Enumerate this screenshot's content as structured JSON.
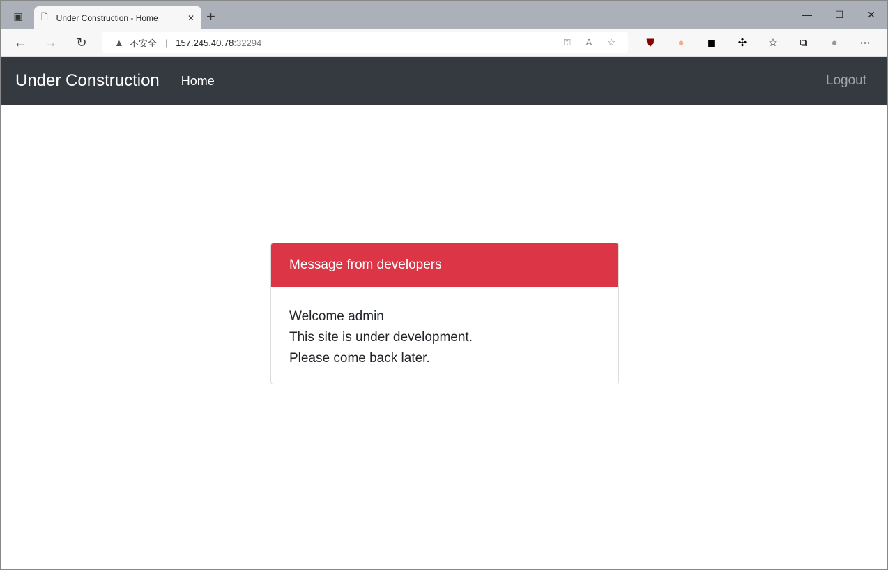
{
  "browser": {
    "tab_title": "Under Construction - Home",
    "security_label": "不安全",
    "url_host": "157.245.40.78",
    "url_port": ":32294"
  },
  "navbar": {
    "brand": "Under Construction",
    "home": "Home",
    "logout": "Logout",
    "bg": "#343a40"
  },
  "card": {
    "header": "Message from developers",
    "lines": [
      "Welcome admin",
      "This site is under development.",
      "Please come back later."
    ],
    "accent": "#dc3545"
  }
}
